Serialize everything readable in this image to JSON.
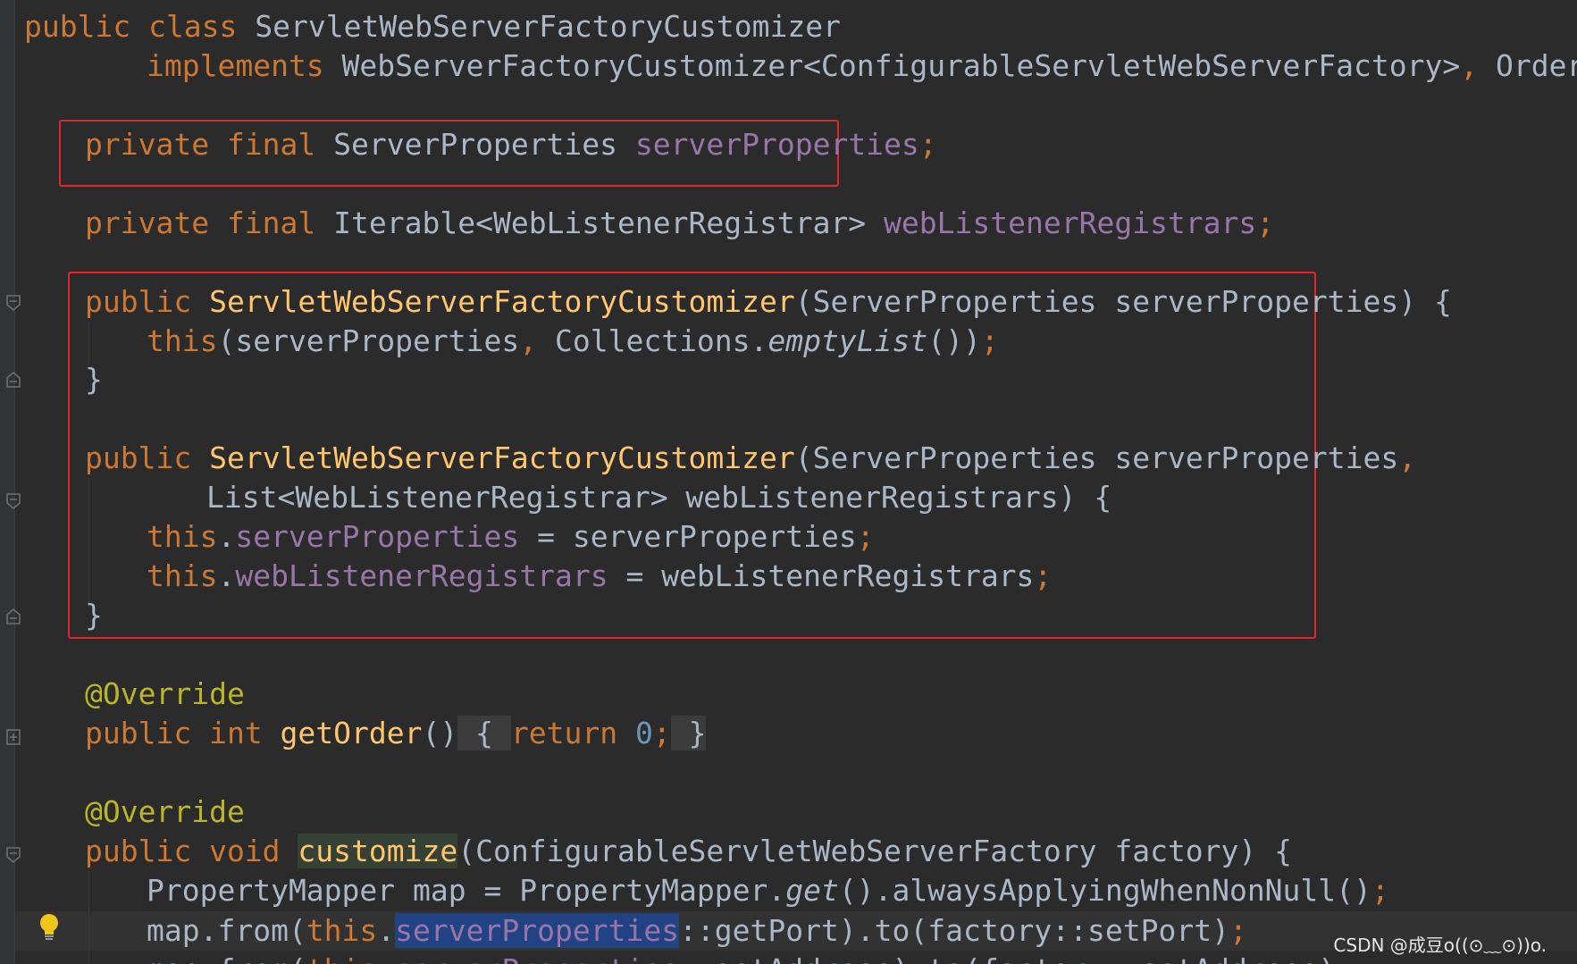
{
  "code": {
    "l1": {
      "kw": "public class",
      "name": " ServletWebServerFactoryCustomizer"
    },
    "l2": {
      "kw": "implements",
      "type": " WebServerFactoryCustomizer<ConfigurableServletWebServerFactory>",
      "comma": ",",
      "rest": " Ordered {"
    },
    "l3": {
      "kw": "private final",
      "type": " ServerProperties ",
      "field": "serverProperties",
      "semi": ";"
    },
    "l4": {
      "kw": "private final",
      "type": " Iterable<WebListenerRegistrar> ",
      "field": "webListenerRegistrars",
      "semi": ";"
    },
    "l5": {
      "kw": "public",
      "fn": " ServletWebServerFactoryCustomizer",
      "rest": "(ServerProperties serverProperties) {"
    },
    "l6": {
      "kw": "this",
      "a": "(serverProperties",
      "comma": ",",
      "b": " Collections.",
      "it": "emptyList",
      "c": "())",
      "semi": ";"
    },
    "l7": {
      "text": "}"
    },
    "l8": {
      "kw": "public",
      "fn": " ServletWebServerFactoryCustomizer",
      "rest": "(ServerProperties serverProperties",
      "comma": ","
    },
    "l9": {
      "text": "List<WebListenerRegistrar> webListenerRegistrars) {"
    },
    "l10": {
      "kw": "this",
      "dot": ".",
      "field": "serverProperties",
      "rest": " = serverProperties",
      "semi": ";"
    },
    "l11": {
      "kw": "this",
      "dot": ".",
      "field": "webListenerRegistrars",
      "rest": " = webListenerRegistrars",
      "semi": ";"
    },
    "l12": {
      "text": "}"
    },
    "l13": {
      "ann": "@Override"
    },
    "l14": {
      "kw": "public int",
      "fn": " getOrder",
      "paren": "()",
      "ob": " { ",
      "ret": "return",
      "num": " 0",
      "semi": ";",
      "cb": " }"
    },
    "l15": {
      "ann": "@Override"
    },
    "l16": {
      "kw": "public void",
      "fn": "customize",
      "rest": "(ConfigurableServletWebServerFactory factory) {"
    },
    "l17": {
      "a": "PropertyMapper map = PropertyMapper.",
      "it": "get",
      "b": "().alwaysApplyingWhenNonNull()",
      "semi": ";"
    },
    "l18": {
      "a": "map.from(",
      "kw": "this",
      "dot": ".",
      "field": "serverProperties",
      "b": "::getPort).to(factory::setPort)",
      "semi": ";"
    },
    "l19": {
      "a": "map.from(",
      "kw": "this",
      "dot": ".",
      "field": "serverProperties",
      "b": "::getAddress).to(factory::setAddress)",
      "semi": ";"
    }
  },
  "watermark": "CSDN @成豆o((⊙﹏⊙))o.",
  "colors": {
    "background": "#2b2b2b",
    "keyword": "#cc7832",
    "field": "#9876aa",
    "method": "#ffc66d",
    "annotation": "#bbb529",
    "number": "#6897bb",
    "text": "#a9b7c6",
    "redbox": "#e0262b",
    "selection": "#214283",
    "usage_highlight": "#344134"
  },
  "icons": [
    "fold-marker-icon",
    "bulb-icon"
  ]
}
